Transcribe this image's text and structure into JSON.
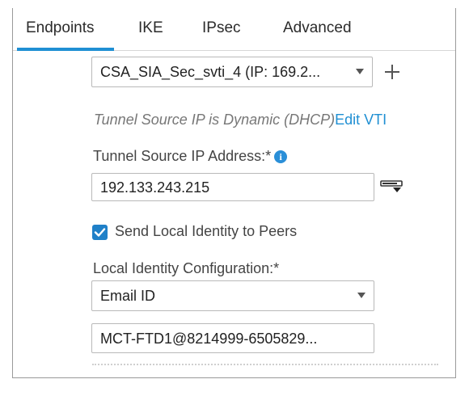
{
  "tabs": [
    {
      "label": "Endpoints",
      "active": true
    },
    {
      "label": "IKE",
      "active": false
    },
    {
      "label": "IPsec",
      "active": false
    },
    {
      "label": "Advanced",
      "active": false
    }
  ],
  "interface_select": {
    "value": "CSA_SIA_Sec_svti_4 (IP: 169.2..."
  },
  "tunnel_note": {
    "text": "Tunnel Source IP is Dynamic (DHCP)",
    "link": "Edit VTI"
  },
  "tunnel_source_ip": {
    "label": "Tunnel Source IP Address:*",
    "value": "192.133.243.215"
  },
  "send_identity": {
    "label": "Send Local Identity to Peers",
    "checked": true
  },
  "local_identity": {
    "label": "Local Identity Configuration:*",
    "type_value": "Email ID",
    "email_value": "MCT-FTD1@8214999-6505829..."
  },
  "icons": {
    "info": "info-icon",
    "plus": "plus-icon",
    "address_picker": "ip-address-picker-icon",
    "checkbox": "checkmark-icon"
  },
  "colors": {
    "accent": "#1f8fd3",
    "checkbox": "#1f80c8",
    "info": "#2a8fd8"
  }
}
